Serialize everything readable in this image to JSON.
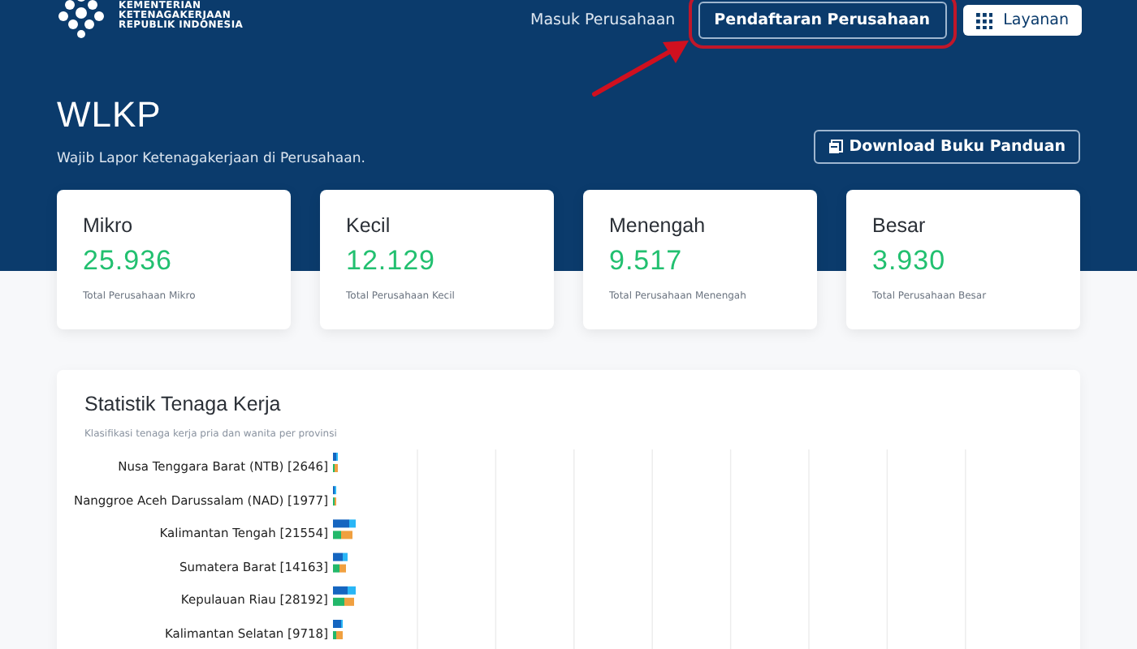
{
  "header": {
    "logo_lines": [
      "KEMENTERIAN",
      "KETENAGAKERJAAN",
      "REPUBLIK INDONESIA"
    ],
    "nav": [
      {
        "kind": "link",
        "label": "Masuk Perusahaan",
        "highlighted": false
      },
      {
        "kind": "outline",
        "label": "Pendaftaran Perusahaan",
        "highlighted": true
      },
      {
        "kind": "menu",
        "label": "Layanan",
        "highlighted": false
      }
    ]
  },
  "hero": {
    "title": "WLKP",
    "subtitle": "Wajib Lapor Ketenagakerjaan di Perusahaan.",
    "button": "Download Buku Panduan"
  },
  "cards": [
    {
      "title": "Mikro",
      "value": "25.936",
      "caption": "Total Perusahaan Mikro"
    },
    {
      "title": "Kecil",
      "value": "12.129",
      "caption": "Total Perusahaan Kecil"
    },
    {
      "title": "Menengah",
      "value": "9.517",
      "caption": "Total Perusahaan Menengah"
    },
    {
      "title": "Besar",
      "value": "3.930",
      "caption": "Total Perusahaan Besar"
    }
  ],
  "statistics": {
    "title": "Statistik Tenaga Kerja",
    "subtitle": "Klasifikasi tenaga kerja pria dan wanita per provinsi",
    "rows": [
      "Nusa Tenggara Barat (NTB) [2646]",
      "Nanggroe Aceh Darussalam (NAD) [1977]",
      "Kalimantan Tengah [21554]",
      "Sumatera Barat [14163]",
      "Kepulauan Riau [28192]",
      "Kalimantan Selatan [9718]"
    ]
  }
}
